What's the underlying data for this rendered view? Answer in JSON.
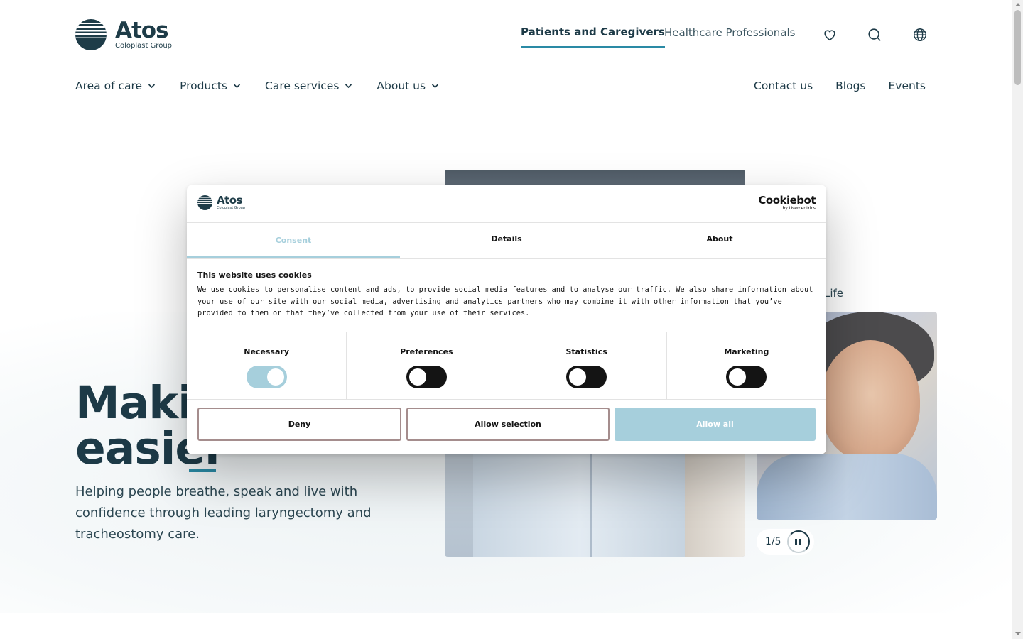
{
  "brand": {
    "name": "Atos",
    "sub": "Coloplast Group"
  },
  "audience": [
    {
      "label": "Patients and Caregivers",
      "active": true
    },
    {
      "label": "Healthcare Professionals",
      "active": false
    }
  ],
  "header_icons": [
    "heart-icon",
    "search-icon",
    "globe-icon"
  ],
  "main_nav": [
    {
      "label": "Area of care"
    },
    {
      "label": "Products"
    },
    {
      "label": "Care services"
    },
    {
      "label": "About us"
    }
  ],
  "side_nav": [
    {
      "label": "Contact us"
    },
    {
      "label": "Blogs"
    },
    {
      "label": "Events"
    }
  ],
  "hero": {
    "title_line1": "Makin",
    "title_line2": "easier",
    "subtitle": "Helping people breathe, speak and live with confidence through leading laryngectomy and tracheostomy care.",
    "slide_caption": "Life",
    "pager": "1/5"
  },
  "cookie_dialog": {
    "brand": {
      "name": "Atos",
      "sub": "Coloplast Group"
    },
    "vendor": {
      "name": "Cookiebot",
      "by": "by Usercentrics"
    },
    "tabs": [
      {
        "label": "Consent",
        "active": true
      },
      {
        "label": "Details",
        "active": false
      },
      {
        "label": "About",
        "active": false
      }
    ],
    "heading": "This website uses cookies",
    "body": "We use cookies to personalise content and ads, to provide social media features and to analyse our traffic. We also share information about your use of our site with our social media, advertising and analytics partners who may combine it with other information that you’ve provided to them or that they’ve collected from your use of their services.",
    "categories": [
      {
        "label": "Necessary",
        "enabled": true
      },
      {
        "label": "Preferences",
        "enabled": false
      },
      {
        "label": "Statistics",
        "enabled": false
      },
      {
        "label": "Marketing",
        "enabled": false
      }
    ],
    "buttons": {
      "deny": "Deny",
      "allow_selection": "Allow selection",
      "allow_all": "Allow all"
    }
  },
  "colors": {
    "text_dark": "#1d3a47",
    "accent_teal": "#2a8aa5",
    "cookie_accent": "#a6cfdc"
  }
}
